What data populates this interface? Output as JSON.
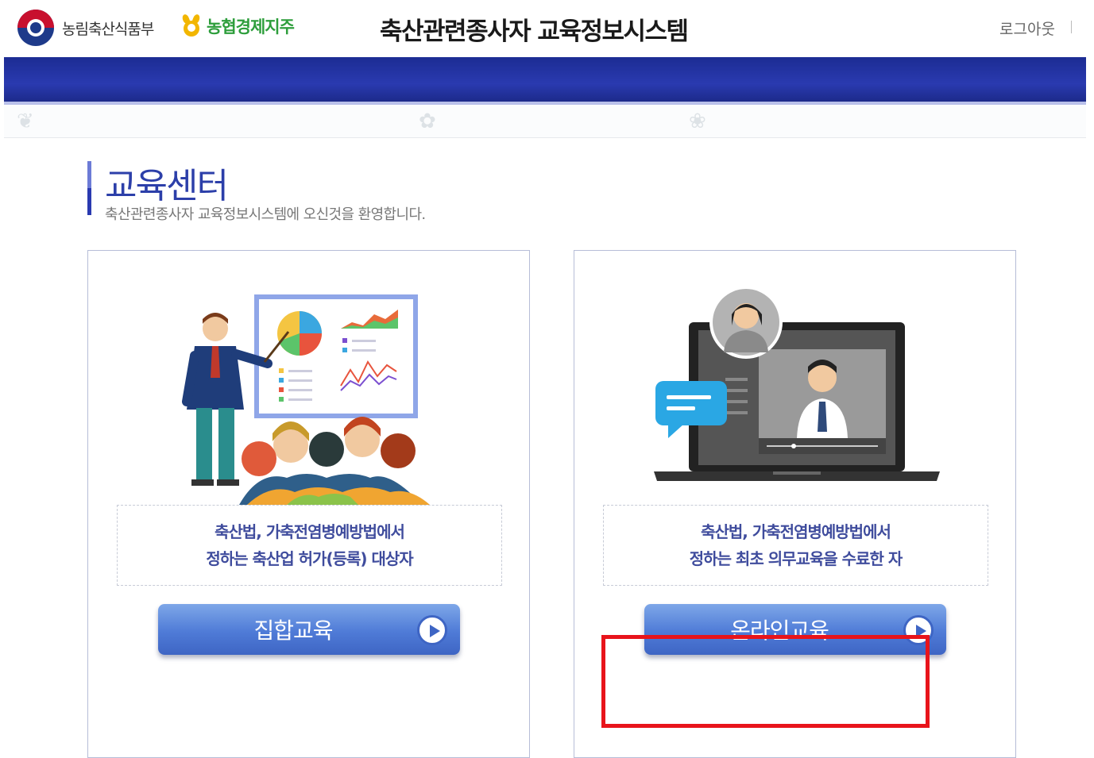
{
  "header": {
    "gov_name": "농림축산식품부",
    "coop_name": "농협경제지주",
    "site_title": "축산관련종사자 교육정보시스템",
    "logout": "로그아웃"
  },
  "section": {
    "title": "교육센터",
    "subtitle": "축산관련종사자 교육정보시스템에 오신것을 환영합니다."
  },
  "cards": [
    {
      "desc_line1": "축산법, 가축전염병예방법에서",
      "desc_line2": "정하는 축산업 허가(등록) 대상자",
      "button_label": "집합교육"
    },
    {
      "desc_line1": "축산법, 가축전염병예방법에서",
      "desc_line2": "정하는 최초 의무교육을 수료한 자",
      "button_label": "온라인교육"
    }
  ],
  "colors": {
    "navbar": "#2a3ab0",
    "title_blue": "#2c3fa9",
    "button_blue": "#4f7bd7",
    "highlight": "#e8141b"
  },
  "icons": [
    "go-arrow-icon",
    "gov-logo-icon",
    "nh-logo-icon"
  ]
}
